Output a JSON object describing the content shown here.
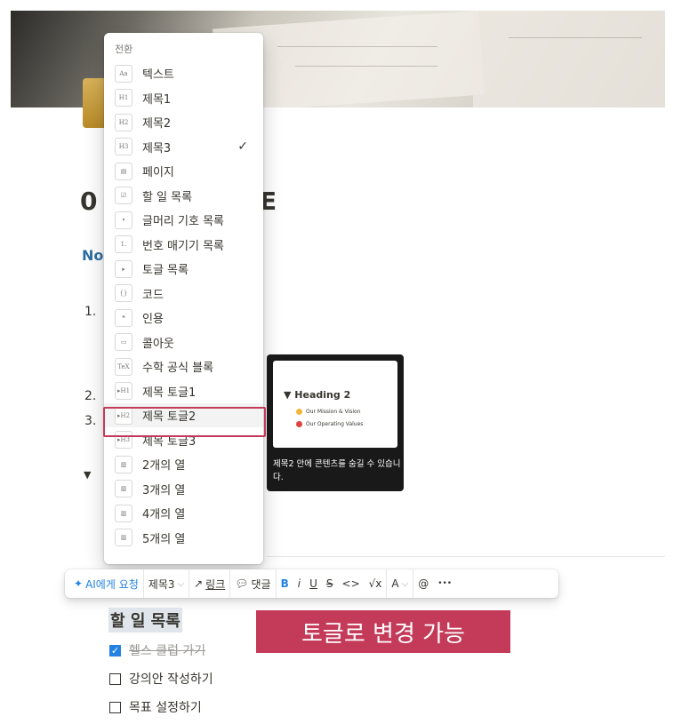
{
  "page": {
    "title_fragment_left": "0",
    "title_fragment_right": "E",
    "subheading_fragment": "No",
    "list_numbers": [
      "1.",
      "2.",
      "3."
    ],
    "toggle_glyph": "▼"
  },
  "menu": {
    "header": "전환",
    "items": [
      {
        "icon": "Aa",
        "label": "텍스트"
      },
      {
        "icon": "H1",
        "label": "제목1"
      },
      {
        "icon": "H2",
        "label": "제목2"
      },
      {
        "icon": "H3",
        "label": "제목3",
        "checked": true
      },
      {
        "icon": "page",
        "label": "페이지"
      },
      {
        "icon": "todo",
        "label": "할 일 목록"
      },
      {
        "icon": "bullet",
        "label": "글머리 기호 목록"
      },
      {
        "icon": "1.",
        "label": "번호 매기기 목록"
      },
      {
        "icon": "toggle",
        "label": "토글 목록"
      },
      {
        "icon": "code",
        "label": "코드"
      },
      {
        "icon": "quote",
        "label": "인용"
      },
      {
        "icon": "callout",
        "label": "콜아웃"
      },
      {
        "icon": "TeX",
        "label": "수학 공식 블록"
      },
      {
        "icon": "toggle-h1",
        "label": "제목 토글1"
      },
      {
        "icon": "toggle-h2",
        "label": "제목 토글2",
        "selected": true
      },
      {
        "icon": "toggle-h3",
        "label": "제목 토글3"
      },
      {
        "icon": "columns",
        "label": "2개의 열"
      },
      {
        "icon": "columns",
        "label": "3개의 열"
      },
      {
        "icon": "columns",
        "label": "4개의 열"
      },
      {
        "icon": "columns",
        "label": "5개의 열"
      }
    ],
    "check_glyph": "✓"
  },
  "preview": {
    "heading": "Heading 2",
    "items": [
      "Our Mission & Vision",
      "Our Operating Values"
    ],
    "description": "제목2 안에 콘텐츠를 숨길 수 있습니다."
  },
  "toolbar": {
    "ai": "AI에게 요청",
    "block_type": "제목3",
    "link": "링크",
    "comment": "댓글",
    "bold": "B",
    "italic": "i",
    "underline": "U",
    "strike": "S",
    "code": "<>",
    "math": "√x",
    "color": "A",
    "mention": "@",
    "more": "•••"
  },
  "content": {
    "todo_heading": "할 일 목록",
    "banner": "토글로 변경 가능",
    "todos": [
      {
        "text": "헬스 클럽 가기",
        "done": true
      },
      {
        "text": "강의안 작성하기",
        "done": false
      },
      {
        "text": "목표 설정하기",
        "done": false
      }
    ]
  },
  "colors": {
    "accent": "#2383e2",
    "highlight": "#c43a59"
  }
}
